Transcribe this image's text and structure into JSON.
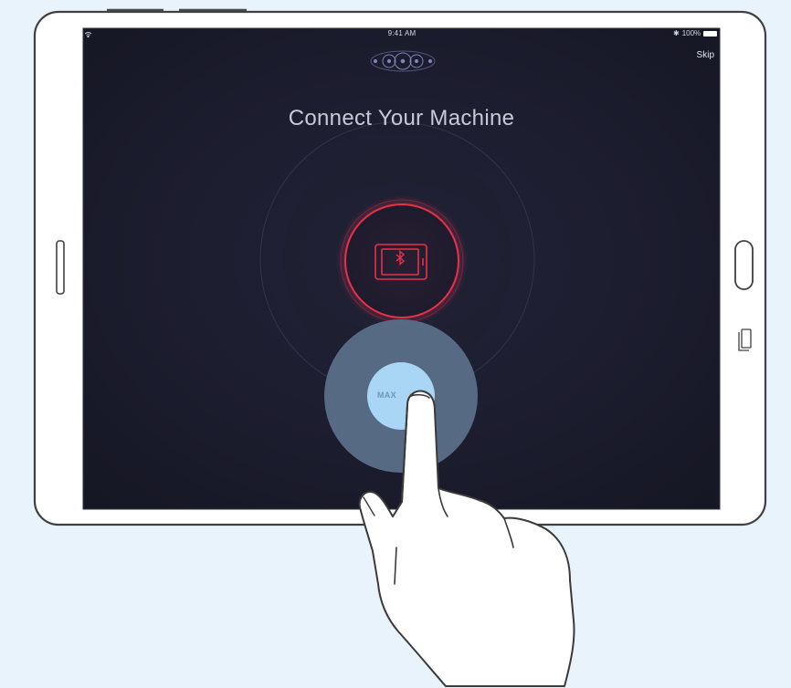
{
  "status_bar": {
    "time": "9:41 AM",
    "battery": "100%"
  },
  "header": {
    "skip_label": "Skip",
    "title": "Connect Your Machine"
  },
  "connect_control": {
    "button_label": "MAX"
  },
  "icons": {
    "wifi": "wifi-icon",
    "bluetooth": "bluetooth-icon",
    "battery": "battery-icon",
    "logo": "brand-logo-icon",
    "machine": "bluetooth-machine-icon",
    "finger": "pointing-hand-icon"
  },
  "colors": {
    "background": "#e9f3fb",
    "screen": "#1a1b2c",
    "accent_red": "#e8304a",
    "touch_blue": "#a9d6f5"
  }
}
